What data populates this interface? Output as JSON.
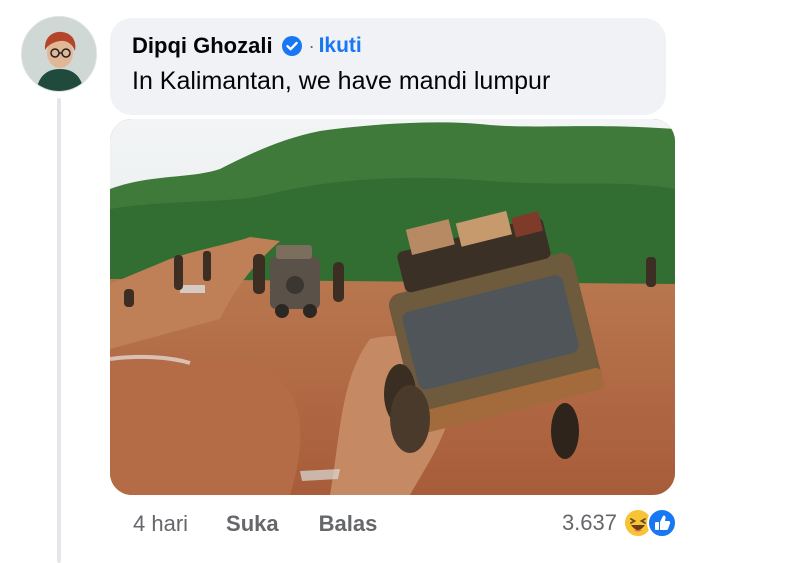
{
  "comment": {
    "author": "Dipqi Ghozali",
    "separator": "·",
    "follow_label": "Ikuti",
    "text": "In Kalimantan, we have mandi lumpur"
  },
  "actions": {
    "time": "4 hari",
    "like_label": "Suka",
    "reply_label": "Balas"
  },
  "reactions": {
    "count": "3.637",
    "icons": [
      "haha-icon",
      "like-icon"
    ]
  },
  "colors": {
    "accent": "#1877f2",
    "bubble": "#f0f2f5",
    "secondary_text": "#65676b",
    "mud": "#b46a45",
    "forest": "#3f7a3a"
  },
  "icons": {
    "verified": "verified-badge-icon",
    "avatar": "avatar"
  }
}
